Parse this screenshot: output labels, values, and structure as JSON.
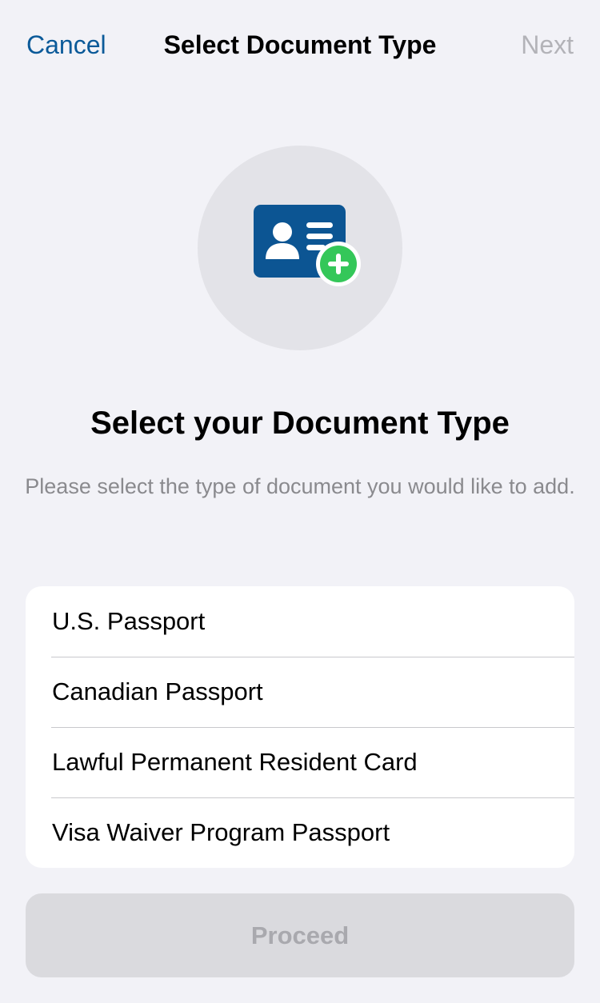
{
  "nav": {
    "cancel_label": "Cancel",
    "title": "Select Document Type",
    "next_label": "Next"
  },
  "hero": {
    "icon": "id-card-add-icon"
  },
  "content": {
    "heading": "Select your Document Type",
    "subtitle": "Please select the type of document you would like to add."
  },
  "options": [
    {
      "label": "U.S. Passport"
    },
    {
      "label": "Canadian Passport"
    },
    {
      "label": "Lawful Permanent Resident Card"
    },
    {
      "label": "Visa Waiver Program Passport"
    }
  ],
  "footer": {
    "proceed_label": "Proceed"
  },
  "colors": {
    "background": "#f2f2f7",
    "link_blue": "#0b5a99",
    "card_blue": "#0c5593",
    "add_green": "#34c759",
    "disabled_text": "#b3b3b8"
  }
}
